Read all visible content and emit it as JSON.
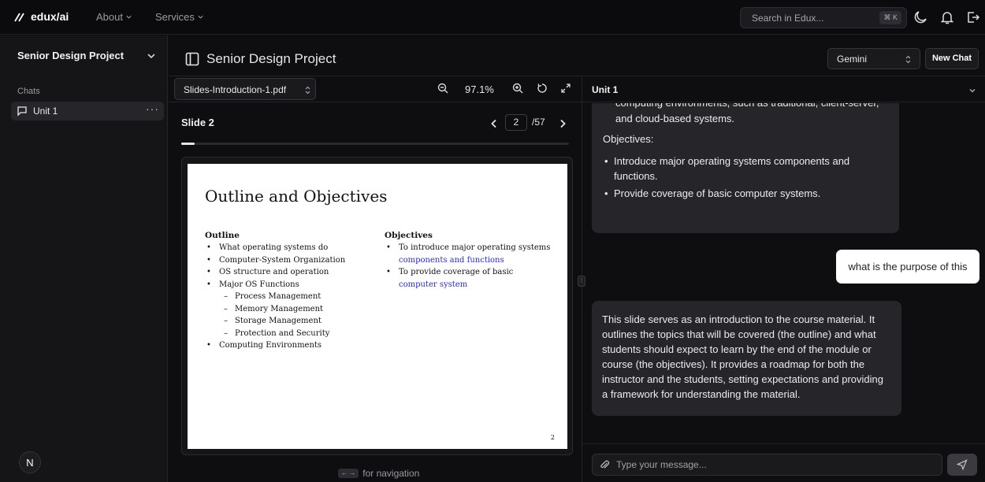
{
  "topbar": {
    "logo": "edux/ai",
    "nav": [
      "About",
      "Services"
    ],
    "search_placeholder": "Search in Edux...",
    "search_shortcut": "⌘ K"
  },
  "sidebar": {
    "project": "Senior Design Project",
    "chats_label": "Chats",
    "chats": [
      {
        "label": "Unit 1",
        "menu": "···"
      }
    ],
    "avatar_initial": "N"
  },
  "header": {
    "title": "Senior Design Project",
    "model": "Gemini",
    "new_chat": "New Chat"
  },
  "pdf": {
    "file": "Slides-Introduction-1.pdf",
    "zoom": "97.1%",
    "slide_label": "Slide 2",
    "page": "2",
    "total": "/57",
    "progress": 0.035,
    "nav_keys": "← →",
    "nav_hint": "for navigation"
  },
  "slide": {
    "title": "Outline and Objectives",
    "outline_header": "Outline",
    "outline": [
      "What operating systems do",
      "Computer-System Organization",
      "OS structure and operation",
      "Major OS Functions"
    ],
    "outline_sub": [
      "Process Management",
      "Memory Management",
      "Storage Management",
      "Protection and Security"
    ],
    "outline_last": "Computing Environments",
    "objectives_header": "Objectives",
    "obj1_a": "To introduce major operating systems",
    "obj1_b": "components and functions",
    "obj2_a": "To provide coverage of basic",
    "obj2_b": "computer system",
    "page_number": "2"
  },
  "chat": {
    "title": "Unit 1",
    "msg1_cut": "computing environments, such as traditional, client-server,",
    "msg1_top": "and cloud-based systems.",
    "msg1_heading": "Objectives:",
    "msg1_items": [
      "Introduce major operating systems components and functions.",
      "Provide coverage of basic computer systems."
    ],
    "user_msg": "what is the purpose of this",
    "reply": "This slide serves as an introduction to the course material. It outlines the topics that will be covered (the outline) and what students should expect to learn by the end of the module or course (the objectives). It provides a roadmap for both the instructor and the students, setting expectations and providing a framework for understanding the material.",
    "input_placeholder": "Type your message..."
  }
}
